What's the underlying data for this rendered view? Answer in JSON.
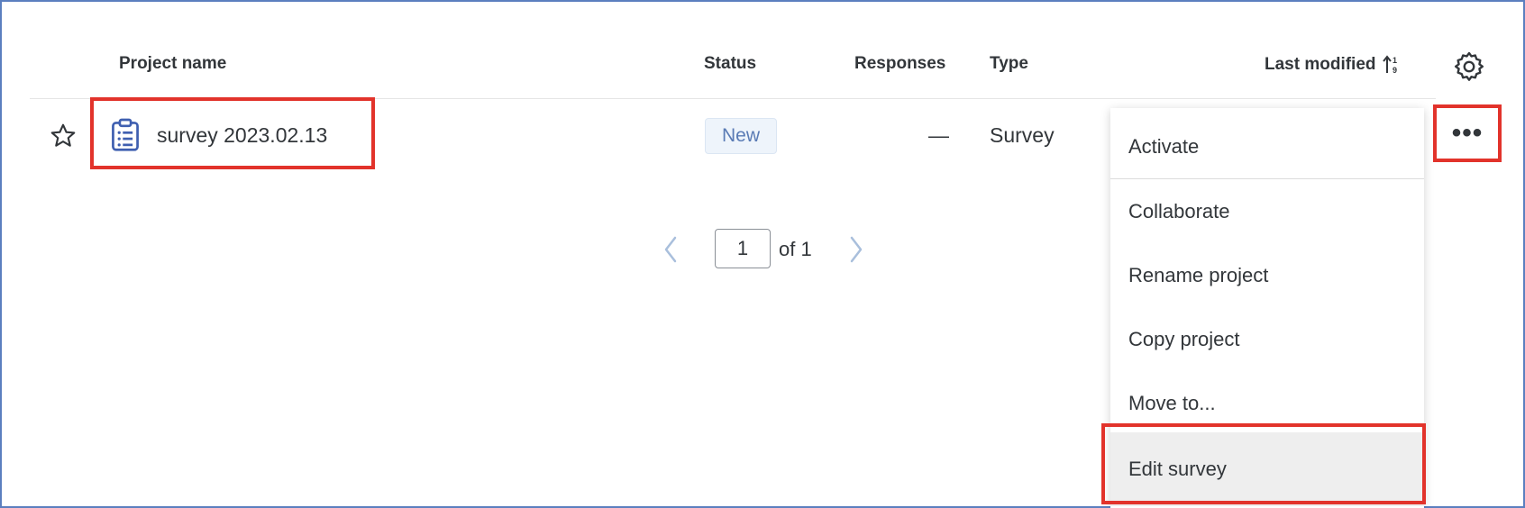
{
  "table": {
    "headers": {
      "project_name": "Project name",
      "status": "Status",
      "responses": "Responses",
      "type": "Type",
      "last_modified": "Last modified"
    },
    "rows": [
      {
        "name": "survey 2023.02.13",
        "status": "New",
        "responses": "—",
        "type": "Survey"
      }
    ]
  },
  "pagination": {
    "current_page": "1",
    "of_label": "of 1"
  },
  "menu": {
    "items": [
      "Activate",
      "Collaborate",
      "Rename project",
      "Copy project",
      "Move to...",
      "Edit survey"
    ],
    "highlighted": "Edit survey"
  },
  "icons": {
    "row_menu": "more-horizontal-icon",
    "settings": "gear-icon",
    "favorite": "star-outline-icon",
    "project": "clipboard-list-icon",
    "sort": "sort-numeric-icon",
    "prev": "chevron-left-icon",
    "next": "chevron-right-icon"
  },
  "colors": {
    "highlight_border": "#e2332b",
    "badge_bg": "#eef4fb",
    "badge_text": "#5a7bb5",
    "frame_border": "#5b7fbf",
    "hover_bg": "#eeeeee"
  },
  "more_glyph": "•••"
}
